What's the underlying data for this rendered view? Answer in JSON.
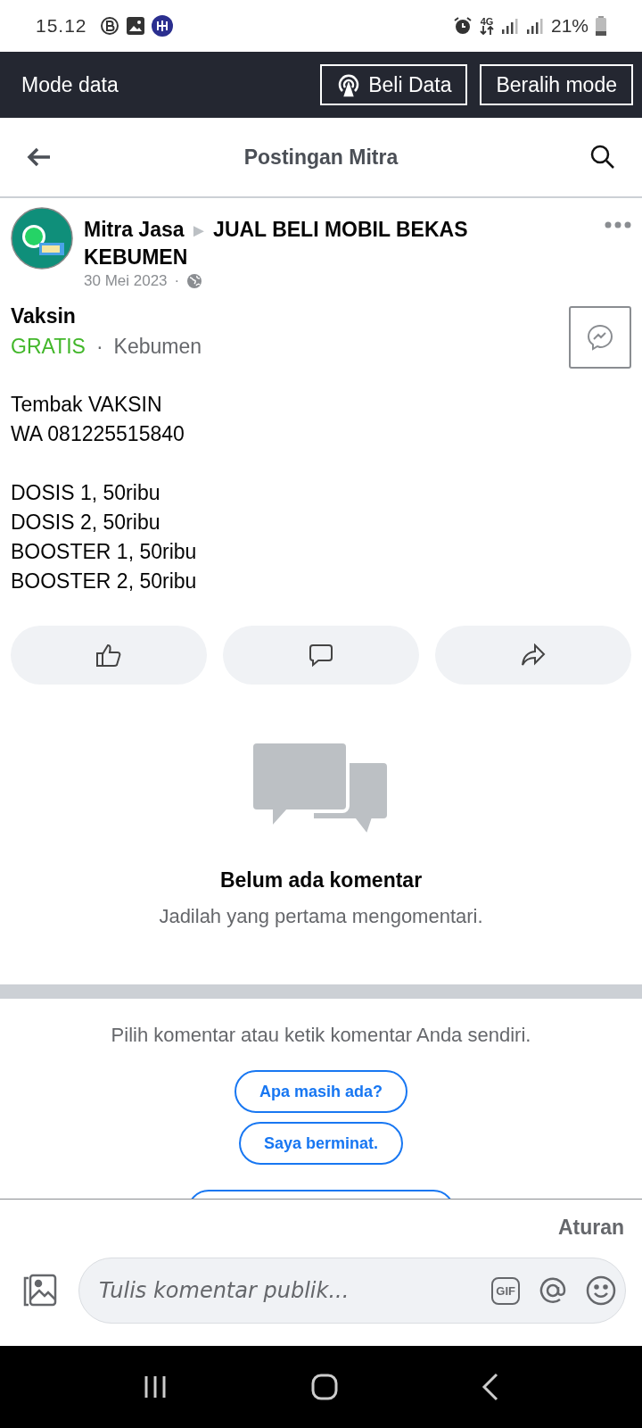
{
  "status_bar": {
    "time": "15.12",
    "network": "4G",
    "battery": "21%"
  },
  "data_mode_bar": {
    "title": "Mode data",
    "buttons": [
      {
        "label": "Beli Data",
        "kind": "icon"
      },
      {
        "label": "Beralih mode",
        "kind": "plain"
      }
    ]
  },
  "header": {
    "title": "Postingan Mitra"
  },
  "post": {
    "author": "Mitra Jasa",
    "author_group_arrow": "►",
    "group": "JUAL BELI MOBIL BEKAS KEBUMEN",
    "date": "30 Mei 2023",
    "separator": "·",
    "item_title": "Vaksin",
    "price": "GRATIS",
    "location_separator": "·",
    "location": "Kebumen",
    "body_paragraphs": [
      [
        "Tembak VAKSIN",
        "WA 081225515840"
      ],
      [
        "DOSIS 1, 50ribu",
        "DOSIS 2, 50ribu",
        "BOOSTER 1, 50ribu",
        "BOOSTER 2, 50ribu"
      ]
    ],
    "actions": [
      {
        "kind": "like"
      },
      {
        "kind": "comment"
      },
      {
        "kind": "share"
      }
    ]
  },
  "empty_comments": {
    "title": "Belum ada komentar",
    "subtitle": "Jadilah yang pertama mengomentari."
  },
  "suggestions": {
    "prompt": "Pilih komentar atau ketik komentar Anda sendiri.",
    "chips": [
      "Apa masih ada?",
      "Saya berminat."
    ]
  },
  "composer": {
    "rules_link": "Aturan",
    "placeholder": "Tulis komentar publik...",
    "gif_label": "GIF"
  }
}
